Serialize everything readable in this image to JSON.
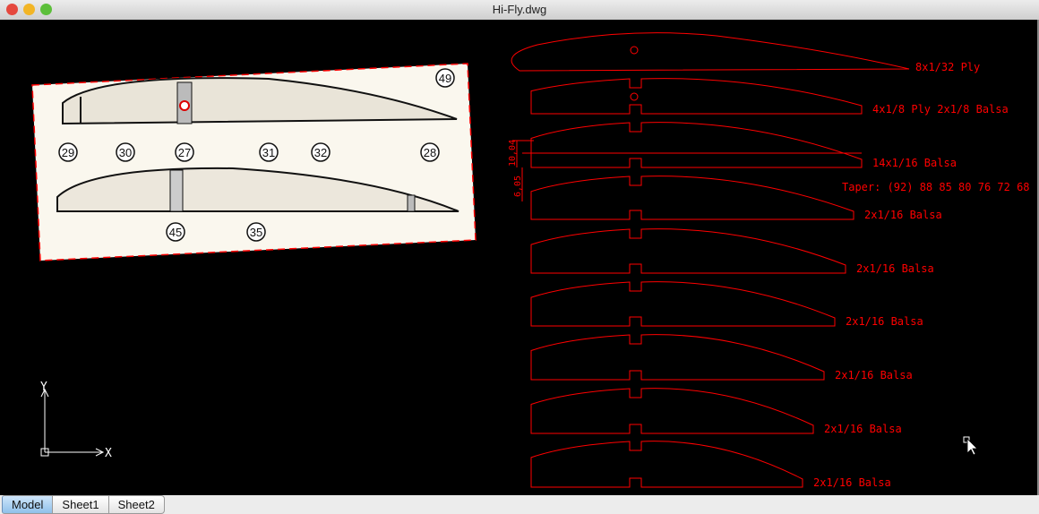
{
  "window": {
    "title": "Hi-Fly.dwg"
  },
  "colors": {
    "drawing": "#ff0000",
    "background": "#000000",
    "scan_paper": "#faf7ee",
    "ucs": "#ffffff"
  },
  "scan": {
    "callouts": [
      "29",
      "30",
      "27",
      "31",
      "32",
      "28",
      "49",
      "45",
      "35"
    ]
  },
  "labels": {
    "top": "8x1/32 Ply",
    "rib1": "4x1/8 Ply 2x1/8 Balsa",
    "rib2": "14x1/16 Balsa",
    "taper": "Taper: (92) 88 85 80 76 72 68",
    "rib3": "2x1/16 Balsa",
    "rib4": "2x1/16 Balsa",
    "rib5": "2x1/16 Balsa",
    "rib6": "2x1/16 Balsa",
    "rib7": "2x1/16 Balsa",
    "rib8": "2x1/16 Balsa"
  },
  "dimensions": {
    "d1": "10,04",
    "d2": "6,05"
  },
  "ucs": {
    "x": "X",
    "y": "Y"
  },
  "tabs": [
    {
      "label": "Model",
      "active": true
    },
    {
      "label": "Sheet1"
    },
    {
      "label": "Sheet2"
    }
  ]
}
